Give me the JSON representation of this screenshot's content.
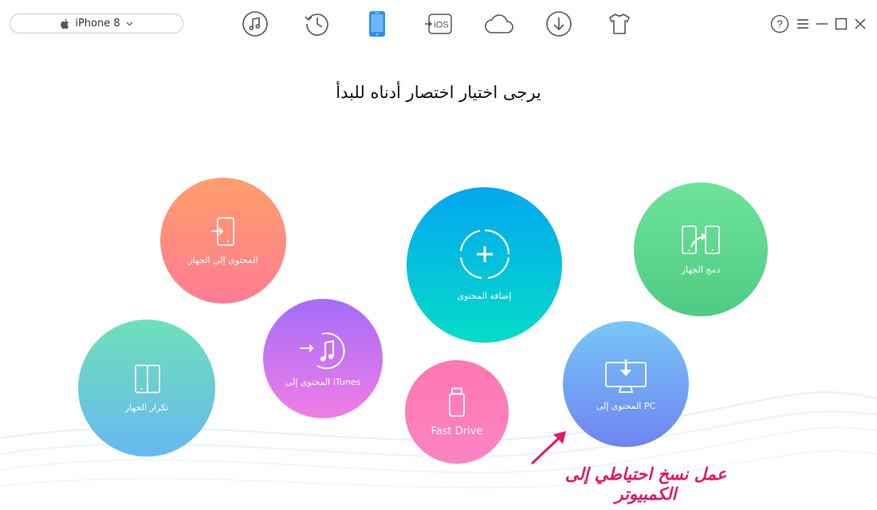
{
  "device": {
    "name": "iPhone 8"
  },
  "toolbar": {
    "icons": [
      "music-icon",
      "history-icon",
      "phone-icon",
      "to-ios-icon",
      "cloud-icon",
      "download-icon",
      "shirt-icon"
    ],
    "to_ios_label": "iOS",
    "active": "phone-icon"
  },
  "window": {
    "help": "?"
  },
  "main": {
    "heading": "يرجى اختيار اختصار أدناه للبدأ"
  },
  "shortcuts": {
    "content_to_device": "المحتوى إلى الجهاز",
    "clone_device": "تكرار الجهاز",
    "content_to_itunes": "المحتوى إلى iTunes",
    "add_content": "إضافة المحتوى",
    "fast_drive": "Fast Drive",
    "merge_device": "دمج الجهاز",
    "content_to_pc": "المحتوى إلى PC"
  },
  "annotation": {
    "text": "عمل نسخ احتياطي إلى الكمبيوتر",
    "color": "#e11a63"
  },
  "colors": {
    "accent": "#2d8ff0",
    "icon_gray": "#555555"
  }
}
